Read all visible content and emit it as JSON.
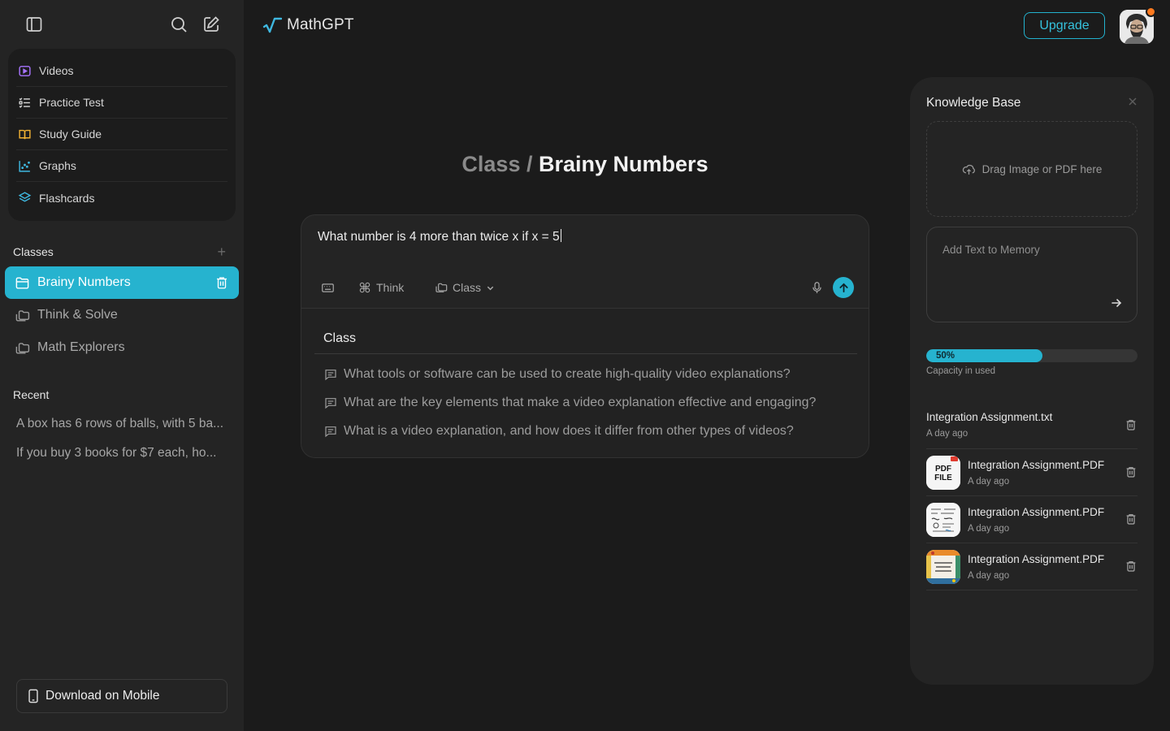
{
  "brand": {
    "name": "MathGPT"
  },
  "header": {
    "upgrade_label": "Upgrade"
  },
  "colors": {
    "accent": "#26b3cf",
    "notification": "#ff7a1f"
  },
  "sidebar": {
    "tools": [
      {
        "label": "Videos",
        "icon": "video-icon",
        "color": "#a874ff"
      },
      {
        "label": "Practice Test",
        "icon": "list-check-icon",
        "color": "#d6d6d6"
      },
      {
        "label": "Study Guide",
        "icon": "book-icon",
        "color": "#f2b233"
      },
      {
        "label": "Graphs",
        "icon": "scatter-chart-icon",
        "color": "#3fb8e0"
      },
      {
        "label": "Flashcards",
        "icon": "layers-icon",
        "color": "#3fb8e0"
      }
    ],
    "classes_title": "Classes",
    "classes": [
      {
        "label": "Brainy Numbers",
        "active": true
      },
      {
        "label": "Think & Solve",
        "active": false
      },
      {
        "label": "Math Explorers",
        "active": false
      }
    ],
    "recent_title": "Recent",
    "recent": [
      "A box has 6 rows of balls, with 5 ba...",
      "If you buy 3 books for $7 each, ho..."
    ],
    "download_label": "Download on Mobile"
  },
  "main": {
    "breadcrumb": {
      "parent": "Class",
      "separator": "/",
      "current": "Brainy Numbers"
    },
    "composer": {
      "prompt": "What number is 4 more than twice x if x = 5",
      "think_label": "Think",
      "class_label": "Class"
    },
    "suggestions": {
      "title": "Class",
      "items": [
        "What tools or software can be used to create high-quality video explanations?",
        "What are the key elements that make a video explanation effective and engaging?",
        "What is a video explanation, and how does it differ from other types of videos?"
      ]
    }
  },
  "knowledge_base": {
    "title": "Knowledge Base",
    "dropzone_label": "Drag Image or PDF here",
    "memory_placeholder": "Add Text to Memory",
    "capacity": {
      "percent": 50,
      "label": "50%",
      "caption": "Capacity in used"
    },
    "files": [
      {
        "name": "Integration Assignment.txt",
        "date": "A day ago",
        "thumb": "none"
      },
      {
        "name": "Integration Assignment.PDF",
        "date": "A day ago",
        "thumb": "pdf-file-icon",
        "thumb_text_1": "PDF",
        "thumb_text_2": "FILE"
      },
      {
        "name": "Integration Assignment.PDF",
        "date": "A day ago",
        "thumb": "notes-thumbnail"
      },
      {
        "name": "Integration Assignment.PDF",
        "date": "A day ago",
        "thumb": "colorful-page-thumbnail"
      }
    ]
  }
}
